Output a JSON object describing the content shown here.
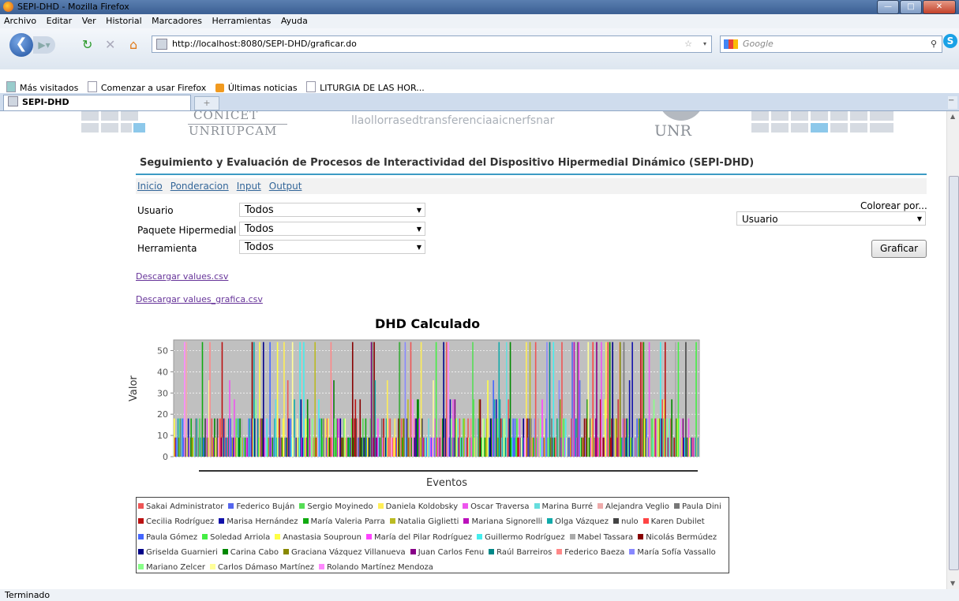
{
  "window": {
    "title": "SEPI-DHD - Mozilla Firefox"
  },
  "menu": [
    "Archivo",
    "Editar",
    "Ver",
    "Historial",
    "Marcadores",
    "Herramientas",
    "Ayuda"
  ],
  "url": "http://localhost:8080/SEPI-DHD/graficar.do",
  "search_placeholder": "Google",
  "bookmarks": [
    "Más visitados",
    "Comenzar a usar Firefox",
    "Últimas noticias",
    "LITURGIA DE LAS HOR..."
  ],
  "tab": {
    "label": "SEPI-DHD"
  },
  "status": "Terminado",
  "banner": {
    "conicet": "CONICET",
    "unriupcam": "UNRIUPCAM",
    "text": "llaollorrasedtransferenciaaicnerfsnar",
    "unr": "UNR"
  },
  "page": {
    "title": "Seguimiento y Evaluación de Procesos de Interactividad del Dispositivo Hipermedial Dinámico (SEPI-DHD)",
    "nav": [
      "Inicio",
      "Ponderacion",
      "Input",
      "Output"
    ],
    "filters": [
      {
        "label": "Usuario",
        "value": "Todos"
      },
      {
        "label": "Paquete Hipermedial",
        "value": "Todos"
      },
      {
        "label": "Herramienta",
        "value": "Todos"
      }
    ],
    "color_by_label": "Colorear por...",
    "color_by_value": "Usuario",
    "graficar": "Graficar",
    "downloads": [
      "Descargar values.csv",
      "Descargar values_grafica.csv"
    ]
  },
  "colors": {
    "accent_rule": "#3c9bc4",
    "link": "#336699"
  },
  "chart_data": {
    "type": "bar",
    "title": "DHD Calculado",
    "xlabel": "Eventos",
    "ylabel": "Valor",
    "ylim": [
      0,
      55
    ],
    "yticks": [
      0,
      10,
      20,
      30,
      40,
      50
    ],
    "grid": true,
    "values_description_levels": [
      9,
      18,
      27,
      36,
      54
    ],
    "series": [
      {
        "name": "Sakai Administrator",
        "color": "#ee5555"
      },
      {
        "name": "Federico Buján",
        "color": "#5566ee"
      },
      {
        "name": "Sergio Moyinedo",
        "color": "#55dd55"
      },
      {
        "name": "Daniela Koldobsky",
        "color": "#ffee55"
      },
      {
        "name": "Oscar Traversa",
        "color": "#ee55ee"
      },
      {
        "name": "Marina Burré",
        "color": "#66dddd"
      },
      {
        "name": "Alejandra Veglio",
        "color": "#eeaaaa"
      },
      {
        "name": "Paula Dini",
        "color": "#777777"
      },
      {
        "name": "Cecilia Rodríguez",
        "color": "#bb1111"
      },
      {
        "name": "Marisa Hernández",
        "color": "#1111aa"
      },
      {
        "name": "María Valeria Parra",
        "color": "#11aa11"
      },
      {
        "name": "Natalia Giglietti",
        "color": "#bbbb22"
      },
      {
        "name": "Mariana Signorelli",
        "color": "#bb11bb"
      },
      {
        "name": "Olga Vázquez",
        "color": "#11aaaa"
      },
      {
        "name": "nulo",
        "color": "#444444"
      },
      {
        "name": "Karen Dubilet",
        "color": "#ff4444"
      },
      {
        "name": "Paula Gómez",
        "color": "#4466ff"
      },
      {
        "name": "Soledad Arriola",
        "color": "#44ee44"
      },
      {
        "name": "Anastasia Souproun",
        "color": "#ffff44"
      },
      {
        "name": "María del Pilar Rodríguez",
        "color": "#ff44ff"
      },
      {
        "name": "Guillermo Rodríguez",
        "color": "#44eeee"
      },
      {
        "name": "Mabel Tassara",
        "color": "#aaaaaa"
      },
      {
        "name": "Nicolás Bermúdez",
        "color": "#880000"
      },
      {
        "name": "Griselda Guarnieri",
        "color": "#000088"
      },
      {
        "name": "Carina Cabo",
        "color": "#008800"
      },
      {
        "name": "Graciana Vázquez Villanueva",
        "color": "#888800"
      },
      {
        "name": "Juan Carlos Fenu",
        "color": "#880088"
      },
      {
        "name": "Raúl Barreiros",
        "color": "#008888"
      },
      {
        "name": "Federico Baeza",
        "color": "#ff8888"
      },
      {
        "name": "María Sofía Vassallo",
        "color": "#8888ff"
      },
      {
        "name": "Mariano Zelcer",
        "color": "#88ff88"
      },
      {
        "name": "Carlos Dámaso Martínez",
        "color": "#ffff99"
      },
      {
        "name": "Rolando Martínez Mendoza",
        "color": "#ff88ff"
      }
    ]
  }
}
